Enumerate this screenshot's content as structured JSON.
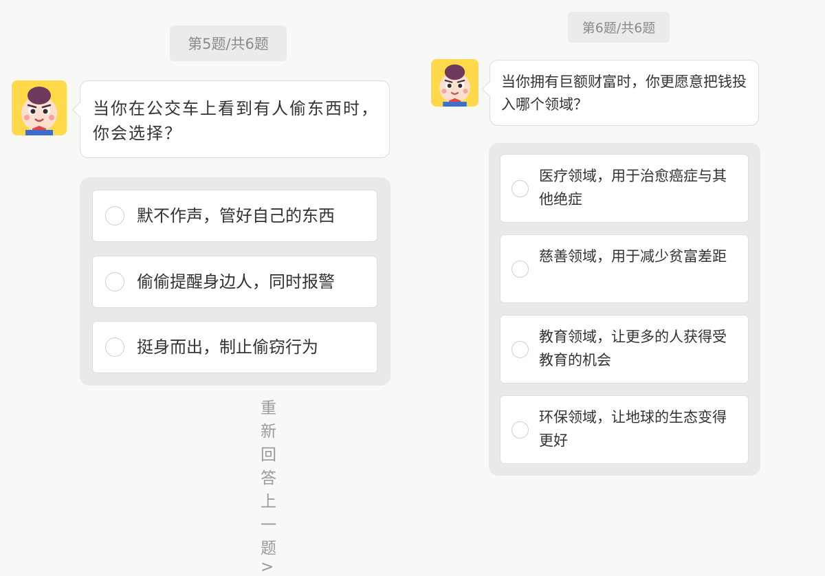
{
  "left": {
    "progress": "第5题/共6题",
    "question": "当你在公交车上看到有人偷东西时，你会选择？",
    "options": [
      "默不作声，管好自己的东西",
      "偷偷提醒身边人，同时报警",
      "挺身而出，制止偷窃行为"
    ],
    "redo": "重新回答上一题>"
  },
  "right": {
    "progress": "第6题/共6题",
    "question": "当你拥有巨额财富时，你更愿意把钱投入哪个领域？",
    "options": [
      "医疗领域，用于治愈癌症与其他绝症",
      "慈善领域，用于减少贫富差距",
      "教育领域，让更多的人获得受教育的机会",
      "环保领域，让地球的生态变得更好"
    ]
  },
  "icons": {
    "avatar": "cartoon-boy-avatar-icon",
    "radio": "radio-unchecked-icon"
  },
  "colors": {
    "background": "#f8f8f6",
    "avatar_bg": "#ffd94a",
    "options_bg": "#e9e9e9",
    "badge_bg": "#ebebeb"
  }
}
